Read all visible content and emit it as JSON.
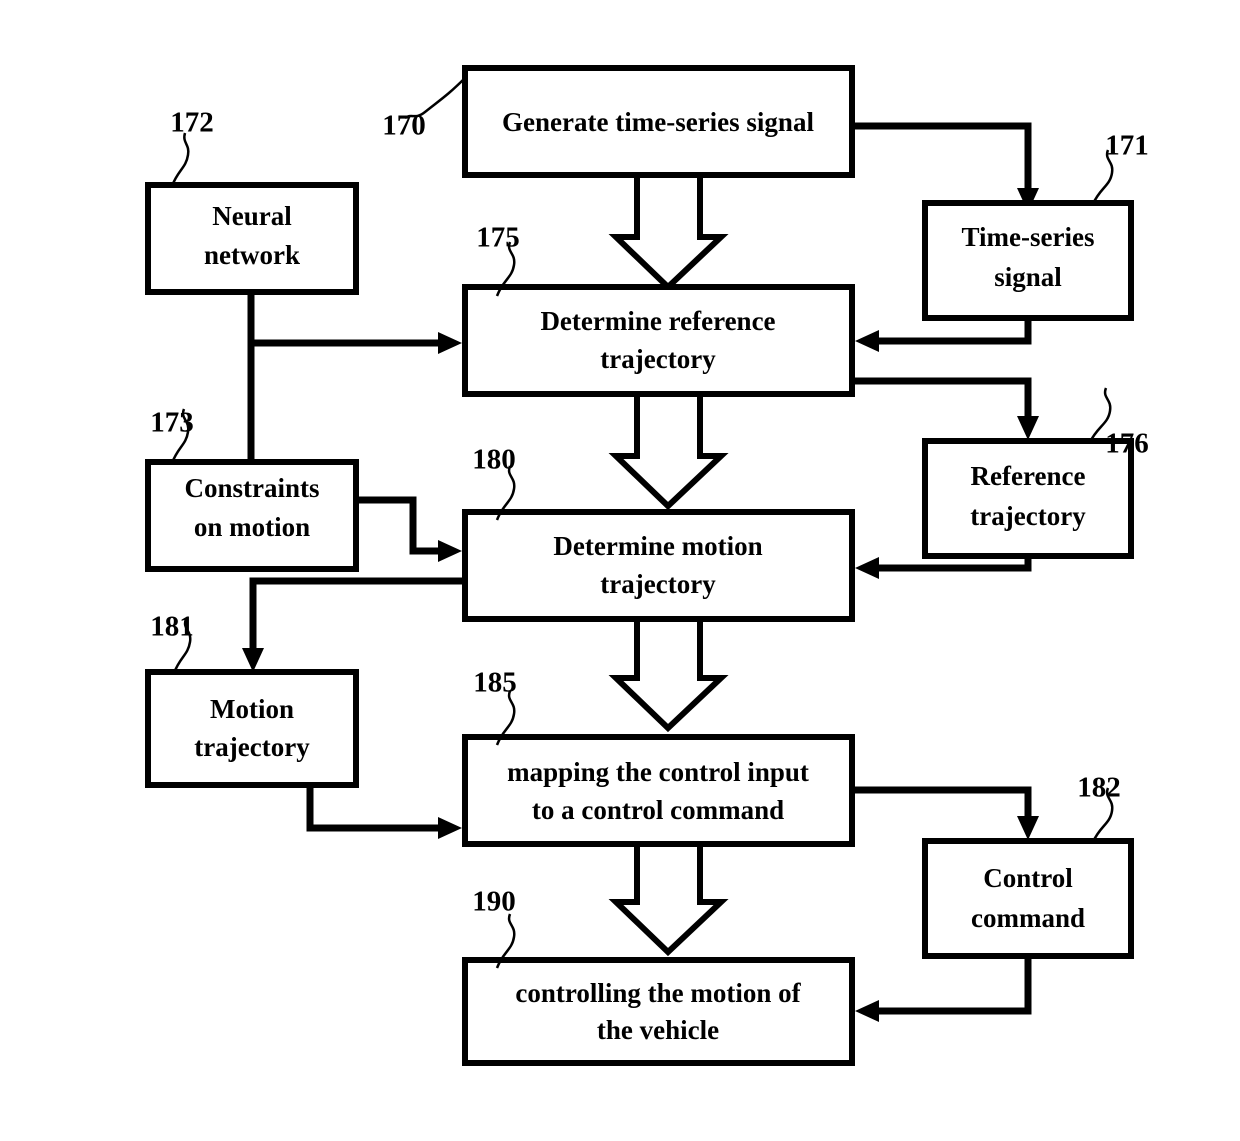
{
  "diagram": {
    "title": "Vehicle motion control flowchart",
    "background_color": "#ffffff",
    "stroke_color": "#000000",
    "nodes": [
      {
        "id": "n170",
        "ref": "170",
        "label_line1": "Generate time-series signal",
        "label_line2": ""
      },
      {
        "id": "n172",
        "ref": "172",
        "label_line1": "Neural",
        "label_line2": "network"
      },
      {
        "id": "n171",
        "ref": "171",
        "label_line1": "Time-series",
        "label_line2": "signal"
      },
      {
        "id": "n175",
        "ref": "175",
        "label_line1": "Determine reference",
        "label_line2": "trajectory"
      },
      {
        "id": "n173",
        "ref": "173",
        "label_line1": "Constraints",
        "label_line2": "on motion"
      },
      {
        "id": "n176",
        "ref": "176",
        "label_line1": "Reference",
        "label_line2": "trajectory"
      },
      {
        "id": "n180",
        "ref": "180",
        "label_line1": "Determine motion",
        "label_line2": "trajectory"
      },
      {
        "id": "n181",
        "ref": "181",
        "label_line1": "Motion",
        "label_line2": "trajectory"
      },
      {
        "id": "n185",
        "ref": "185",
        "label_line1": "mapping the control input",
        "label_line2": "to a control command"
      },
      {
        "id": "n182",
        "ref": "182",
        "label_line1": "Control",
        "label_line2": "command"
      },
      {
        "id": "n190",
        "ref": "190",
        "label_line1": "controlling the motion of",
        "label_line2": "the vehicle"
      }
    ]
  }
}
